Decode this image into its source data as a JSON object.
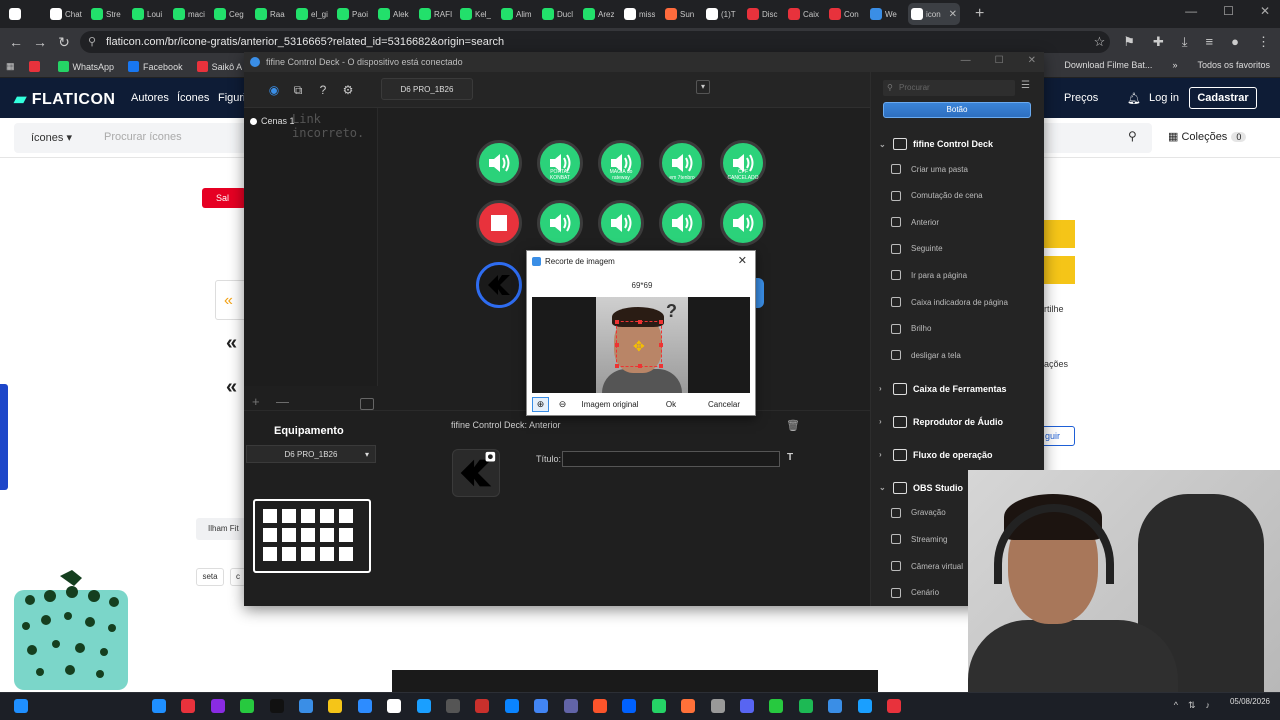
{
  "browser": {
    "tabs": [
      {
        "title": "",
        "color": "#ffffff"
      },
      {
        "title": "Chat",
        "color": "#ffffff"
      },
      {
        "title": "Stre",
        "color": "#22e06b"
      },
      {
        "title": "Loui",
        "color": "#22e06b"
      },
      {
        "title": "maci",
        "color": "#22e06b"
      },
      {
        "title": "Ceg",
        "color": "#22e06b"
      },
      {
        "title": "Raa",
        "color": "#22e06b"
      },
      {
        "title": "el_gi",
        "color": "#22e06b"
      },
      {
        "title": "Paoi",
        "color": "#22e06b"
      },
      {
        "title": "Alek",
        "color": "#22e06b"
      },
      {
        "title": "RAFI",
        "color": "#22e06b"
      },
      {
        "title": "Kel_",
        "color": "#22e06b"
      },
      {
        "title": "Alim",
        "color": "#22e06b"
      },
      {
        "title": "Ducl",
        "color": "#22e06b"
      },
      {
        "title": "Arez",
        "color": "#22e06b"
      },
      {
        "title": "miss",
        "color": "#ffffff"
      },
      {
        "title": "Sun",
        "color": "#ff6b3d"
      },
      {
        "title": "(1)T",
        "color": "#ffffff"
      },
      {
        "title": "Disc",
        "color": "#e8323c"
      },
      {
        "title": "Caix",
        "color": "#e8323c"
      },
      {
        "title": "Con",
        "color": "#e8323c"
      },
      {
        "title": "We",
        "color": "#3a8ee6"
      },
      {
        "title": "icon",
        "color": "#ffffff"
      }
    ],
    "active_tab": "",
    "url": "flaticon.com/br/icone-gratis/anterior_5316665?related_id=5316682&origin=search",
    "bookmarks": [
      {
        "label": "",
        "color": "#e8323c"
      },
      {
        "label": "WhatsApp",
        "color": "#25d366"
      },
      {
        "label": "Facebook",
        "color": "#1877f2"
      },
      {
        "label": "Saikô A",
        "color": "#e8323c"
      }
    ],
    "bookmarks_right": [
      "Download Filme Bat...",
      "»",
      "Todos os favoritos"
    ]
  },
  "flaticon": {
    "logo": "FLATICON",
    "nav": [
      "Autores",
      "Ícones",
      "Figuri"
    ],
    "precos": "Preços",
    "login": "Log in",
    "cadastrar": "Cadastrar",
    "category": "ícones",
    "search_placeholder": "Procurar ícones",
    "colecoes": "Coleções",
    "colecoes_count": "0",
    "save_btn": "Sal",
    "side_texts": [
      "rtilhe",
      "ações",
      "guir"
    ],
    "tags": [
      "Ilham Fit",
      "seta",
      "c"
    ]
  },
  "app": {
    "title": "fifine Control Deck - O dispositivo está conectado",
    "device_tab": "D6 PRO_1B26",
    "scene": "Cenas 1",
    "overlay_text": "Link incorreto.",
    "buttons": [
      {
        "label": "",
        "kind": "sound"
      },
      {
        "label": "PORTAL KONBAT",
        "kind": "sound"
      },
      {
        "label": "MAGIA do rateway",
        "kind": "sound"
      },
      {
        "label": "em 7tenbro",
        "kind": "sound"
      },
      {
        "label": "CPF CANCELADO",
        "kind": "sound"
      },
      {
        "label": "",
        "kind": "stop"
      },
      {
        "label": "",
        "kind": "sound"
      },
      {
        "label": "",
        "kind": "sound"
      },
      {
        "label": "",
        "kind": "sound"
      },
      {
        "label": "",
        "kind": "sound"
      },
      {
        "label": "",
        "kind": "back"
      }
    ],
    "equip_title": "Equipamento",
    "equip_device": "D6 PRO_1B26",
    "breadcrumb": "fifine Control Deck: Anterior",
    "titulo_label": "Título:",
    "titulo_value": "",
    "right_panel": {
      "search_placeholder": "Procurar",
      "tab": "Botão",
      "sections": [
        {
          "label": "fifine Control Deck",
          "expanded": true,
          "items": [
            "Criar uma pasta",
            "Comutação de cena",
            "Anterior",
            "Seguinte",
            "Ir para a página",
            "Caixa indicadora de página",
            "Brilho",
            "desligar a tela"
          ]
        },
        {
          "label": "Caixa de Ferramentas",
          "expanded": false,
          "items": []
        },
        {
          "label": "Reprodutor de Áudio",
          "expanded": false,
          "items": []
        },
        {
          "label": "Fluxo de operação",
          "expanded": false,
          "items": []
        },
        {
          "label": "OBS Studio",
          "expanded": true,
          "items": [
            "Gravação",
            "Streaming",
            "Câmera virtual",
            "Cenário"
          ]
        }
      ]
    }
  },
  "dialog": {
    "title": "Recorte de imagem",
    "size": "69*69",
    "original_btn": "Imagem original",
    "ok_btn": "Ok",
    "cancel_btn": "Cancelar"
  },
  "taskbar": {
    "date": "05/08/2026"
  }
}
